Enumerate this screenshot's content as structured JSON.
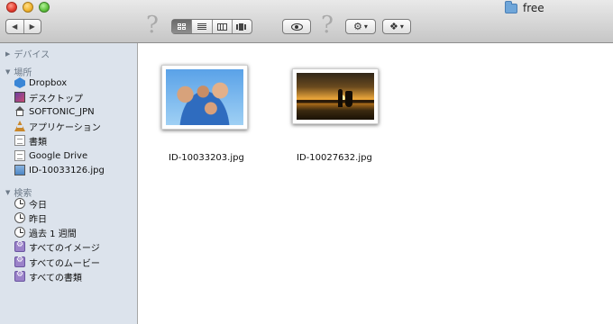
{
  "window": {
    "title": "free"
  },
  "toolbar": {
    "back_icon": "◀",
    "forward_icon": "▶",
    "help_glyph_1": "?",
    "help_glyph_2": "?",
    "gear_icon": "⚙",
    "gear_caret": "▾",
    "dropbox_icon": "❖",
    "dropbox_caret": "▾"
  },
  "sidebar": {
    "devices_header": "デバイス",
    "places_header": "場所",
    "places": [
      {
        "label": "Dropbox",
        "icon": "dropbox-icon"
      },
      {
        "label": "デスクトップ",
        "icon": "desktop-icon"
      },
      {
        "label": "SOFTONIC_JPN",
        "icon": "home-icon"
      },
      {
        "label": "アプリケーション",
        "icon": "applications-icon"
      },
      {
        "label": "書類",
        "icon": "documents-icon"
      },
      {
        "label": "Google Drive",
        "icon": "google-drive-icon"
      },
      {
        "label": "ID-10033126.jpg",
        "icon": "image-file-icon"
      }
    ],
    "search_header": "検索",
    "searches": [
      {
        "label": "今日",
        "icon": "clock-icon"
      },
      {
        "label": "昨日",
        "icon": "clock-icon"
      },
      {
        "label": "過去 1 週間",
        "icon": "clock-icon"
      },
      {
        "label": "すべてのイメージ",
        "icon": "smart-folder-icon"
      },
      {
        "label": "すべてのムービー",
        "icon": "smart-folder-icon"
      },
      {
        "label": "すべての書類",
        "icon": "smart-folder-icon"
      }
    ]
  },
  "files": [
    {
      "name": "ID-10033203.jpg",
      "thumbnail": "group-photo"
    },
    {
      "name": "ID-10027632.jpg",
      "thumbnail": "sunset-couple-photo"
    }
  ]
}
